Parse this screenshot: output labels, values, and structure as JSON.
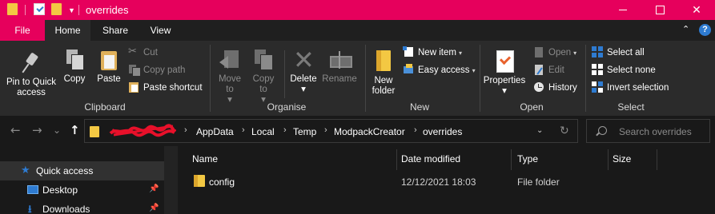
{
  "colors": {
    "accent": "#e6005c",
    "ribbon_bg": "#2b2b2b",
    "window_bg": "#191919",
    "folder_yellow": "#f3c843",
    "selection_blue": "#2e7bd1"
  },
  "titlebar": {
    "title": "overrides",
    "minimize_icon": "minimize-icon",
    "maximize_icon": "maximize-icon",
    "close_glyph": "✕"
  },
  "ribbon_tabs": [
    {
      "label": "File"
    },
    {
      "label": "Home"
    },
    {
      "label": "Share"
    },
    {
      "label": "View"
    }
  ],
  "ribbon_controls": {
    "collapse_glyph": "⌃",
    "help_glyph": "?"
  },
  "ribbon": {
    "clipboard": {
      "label": "Clipboard",
      "pin": "Pin to Quick access",
      "copy": "Copy",
      "paste": "Paste",
      "cut": "Cut",
      "copy_path": "Copy path",
      "paste_shortcut": "Paste shortcut"
    },
    "organise": {
      "label": "Organise",
      "move_to": "Move to",
      "copy_to": "Copy to",
      "delete": "Delete",
      "rename": "Rename",
      "arrow": "▾",
      "x_glyph": "✕"
    },
    "new": {
      "label": "New",
      "new_folder": "New folder",
      "new_item": "New item",
      "easy_access": "Easy access"
    },
    "open": {
      "label": "Open",
      "properties": "Properties",
      "open": "Open",
      "edit": "Edit",
      "history": "History"
    },
    "select": {
      "label": "Select",
      "select_all": "Select all",
      "select_none": "Select none",
      "invert_selection": "Invert selection"
    }
  },
  "address": {
    "back_glyph": "←",
    "forward_glyph": "→",
    "recent_glyph": "⌄",
    "up_glyph": "↑",
    "crumbs": [
      "AppData",
      "Local",
      "Temp",
      "ModpackCreator",
      "overrides"
    ],
    "chevron": "›",
    "dropdown_glyph": "⌄",
    "refresh_glyph": "↻",
    "search_placeholder": "Search overrides"
  },
  "navpane": {
    "items": [
      {
        "label": "Quick access",
        "icon": "star-icon",
        "star": "★"
      },
      {
        "label": "Desktop",
        "icon": "desktop-icon",
        "pinned": "📌"
      },
      {
        "label": "Downloads",
        "icon": "download-icon",
        "arrow": "⭳",
        "pinned": "📌"
      }
    ]
  },
  "filelist": {
    "columns": [
      "Name",
      "Date modified",
      "Type",
      "Size"
    ],
    "rows": [
      {
        "name": "config",
        "date": "12/12/2021 18:03",
        "type": "File folder",
        "size": ""
      }
    ]
  }
}
